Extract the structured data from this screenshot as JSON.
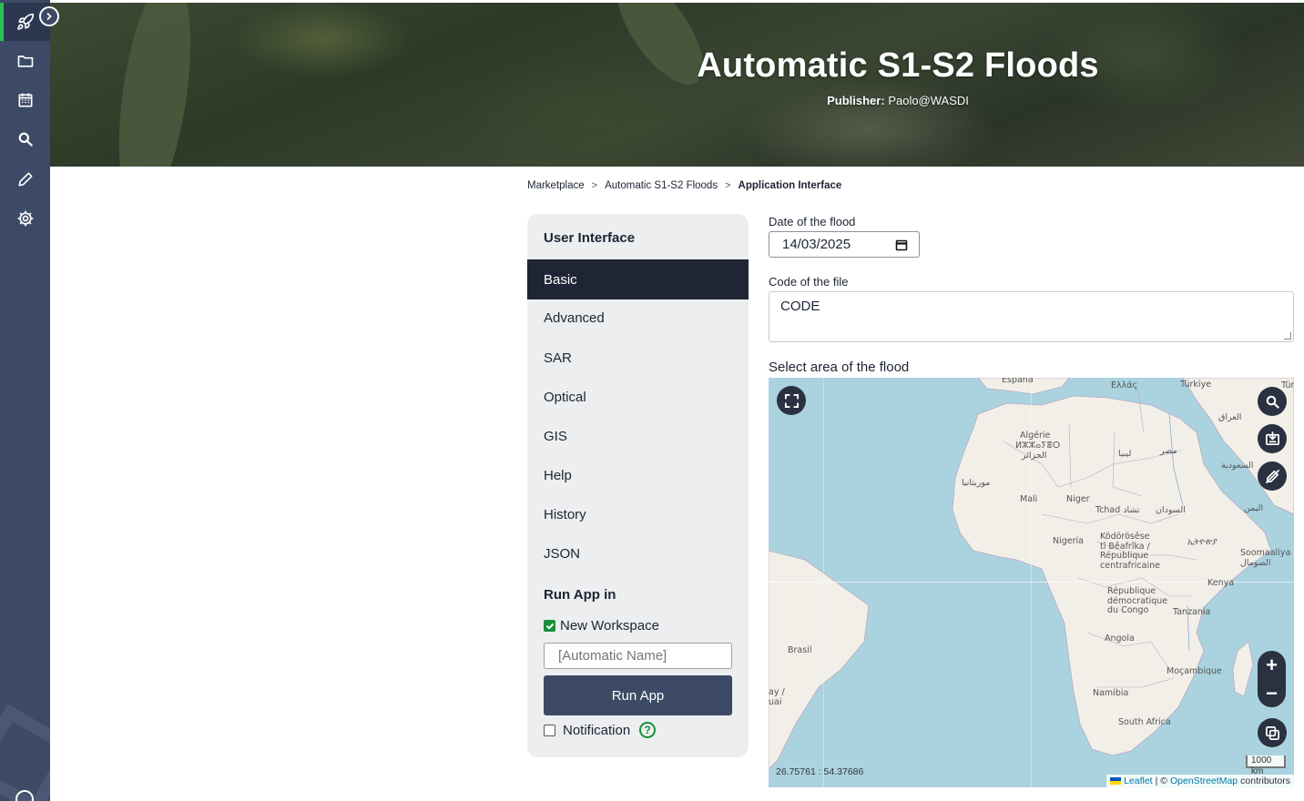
{
  "header": {
    "title": "Automatic S1-S2 Floods",
    "publisher_label": "Publisher:",
    "publisher_value": "Paolo@WASDI"
  },
  "rail": {
    "icons": [
      "rocket-icon",
      "folder-icon",
      "calendar-icon",
      "search-icon",
      "pencil-icon",
      "gear-icon"
    ],
    "accent": "#2dbe5a"
  },
  "breadcrumb": {
    "items": [
      "Marketplace",
      "Automatic S1-S2 Floods",
      "Application Interface"
    ],
    "separator": ">"
  },
  "menu": {
    "title": "User Interface",
    "items": [
      "Basic",
      "Advanced",
      "SAR",
      "Optical",
      "GIS",
      "Help",
      "History",
      "JSON"
    ],
    "active": "Basic",
    "run_title": "Run App in",
    "new_workspace_label": "New Workspace",
    "new_workspace_checked": true,
    "workspace_placeholder": "[Automatic Name]",
    "run_button": "Run App",
    "notification_label": "Notification",
    "notification_checked": false,
    "help_glyph": "?"
  },
  "form": {
    "date_label": "Date of the flood",
    "date_value": "14/03/2025",
    "code_label": "Code of the file",
    "code_value": "CODE",
    "area_label": "Select area of the flood"
  },
  "map": {
    "labels": {
      "espana": "España",
      "ellas": "Ελλάς",
      "turkiye": "Türkiye",
      "turk": "Türk",
      "iraq": "العراق",
      "algerie": "Algérie",
      "algerie_tif": "ⵍⵣⵣⴰⵢⴻⵔ",
      "algerie_ar": "الجزائر",
      "libya": "ليبيا",
      "misr": "مصر",
      "saudi": "السعودية",
      "mauritania": "موريتانيا",
      "mali": "Mali",
      "niger": "Niger",
      "tchad": "Tchad تشاد",
      "sudan": "السودان",
      "yemen": "اليمن",
      "nigeria": "Nigeria",
      "car": "Ködörösêse\ntî Bêafrîka /\nRépublique\ncentrafricaine",
      "ethiopia": "ኢትዮጵያ",
      "somalia": "Soomaaliya\nالصومال",
      "kenya": "Kenya",
      "drc": "République\ndémocratique\ndu Congo",
      "tanzania": "Tanzania",
      "brasil": "Brasil",
      "angola": "Angola",
      "mocambique": "Moçambique",
      "namibia": "Namibia",
      "south_africa": "South Africa",
      "partial_left": "ay /\nuai"
    },
    "zoom_in": "+",
    "zoom_out": "−",
    "scale": "1000 km",
    "coords": "26.75761 : 54.37686",
    "attribution_leaflet": "Leaflet",
    "attribution_sep": "| ©",
    "attribution_osm": "OpenStreetMap",
    "attribution_suffix": "contributors",
    "ocean_color": "#aad3df",
    "land_color": "#f2efe9"
  }
}
